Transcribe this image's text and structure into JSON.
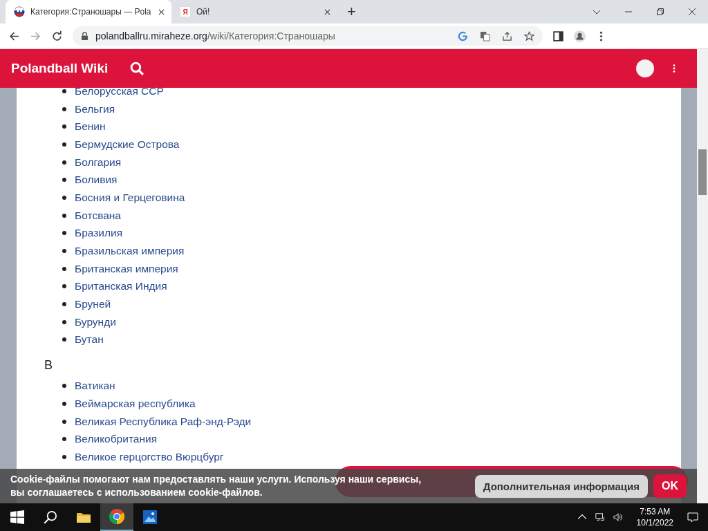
{
  "browser": {
    "tabs": [
      {
        "title": "Категория:Страношары — Pola",
        "selected": true,
        "kind": "ball"
      },
      {
        "title": "Ой!",
        "selected": false,
        "kind": "letter",
        "icon_text": "Я"
      }
    ],
    "new_tab": "+",
    "url_host": "polandballru.miraheze.org",
    "url_path": "/wiki/Категория:Страношары"
  },
  "site": {
    "title": "Polandball Wiki"
  },
  "sections": [
    {
      "items": [
        "Белорусская ССР",
        "Бельгия",
        "Бенин",
        "Бермудские Острова",
        "Болгария",
        "Боливия",
        "Босния и Герцеговина",
        "Ботсвана",
        "Бразилия",
        "Бразильская империя",
        "Британская империя",
        "Британская Индия",
        "Бруней",
        "Бурунди",
        "Бутан"
      ]
    },
    {
      "heading": "В",
      "items": [
        "Ватикан",
        "Веймарская республика",
        "Великая Республика Раф-энд-Рэди",
        "Великобритания",
        "Великое герцогство Вюрцбург"
      ]
    }
  ],
  "cookie_notice": {
    "lines": [
      "Cookie-файлы помогают нам предоставлять наши услуги. Используя наши сервисы,",
      "вы соглашаетесь с использованием cookie-файлов."
    ],
    "more_button": "Дополнительная информация",
    "ok_button": "OK"
  },
  "taskbar": {
    "time": "7:53 AM",
    "date": "10/1/2022"
  }
}
